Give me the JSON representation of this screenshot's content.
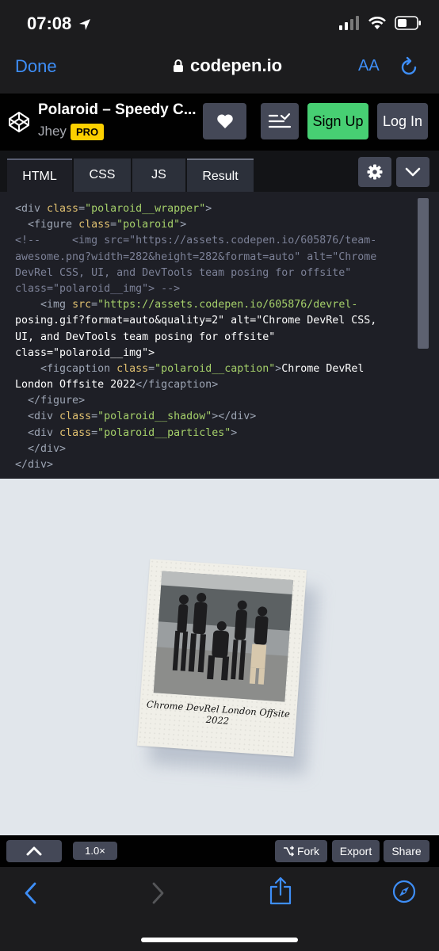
{
  "status_bar": {
    "time": "07:08"
  },
  "safari": {
    "done_label": "Done",
    "url": "codepen.io",
    "text_size_label": "AA"
  },
  "codepen": {
    "pen_title": "Polaroid – Speedy C...",
    "author": "Jhey",
    "pro_badge": "PRO",
    "signup_label": "Sign Up",
    "login_label": "Log In",
    "tabs": [
      {
        "label": "HTML",
        "active": true
      },
      {
        "label": "CSS",
        "active": false
      },
      {
        "label": "JS",
        "active": false
      },
      {
        "label": "Result",
        "active": false
      }
    ]
  },
  "code_lines": [
    "<div class=\"polaroid__wrapper\">",
    "  <figure class=\"polaroid\">",
    "<!--     <img src=\"https://assets.codepen.io/605876/team-",
    "awesome.png?width=282&height=282&format=auto\" alt=\"Chrome",
    "DevRel CSS, UI, and DevTools team posing for offsite\"",
    "class=\"polaroid__img\"> -->",
    "    <img src=\"https://assets.codepen.io/605876/devrel-",
    "posing.gif?format=auto&quality=2\" alt=\"Chrome DevRel CSS,",
    "UI, and DevTools team posing for offsite\"",
    "class=\"polaroid__img\">",
    "    <figcaption class=\"polaroid__caption\">Chrome DevRel",
    "London Offsite 2022</figcaption>",
    "  </figure>",
    "  <div class=\"polaroid__shadow\"></div>",
    "  <div class=\"polaroid__particles\">",
    "  </div>",
    "</div>"
  ],
  "result": {
    "caption_line1": "Chrome DevRel London Offsite",
    "caption_line2": "2022"
  },
  "bottom_bar": {
    "zoom": "1.0×",
    "fork_label": "Fork",
    "export_label": "Export",
    "share_label": "Share"
  }
}
